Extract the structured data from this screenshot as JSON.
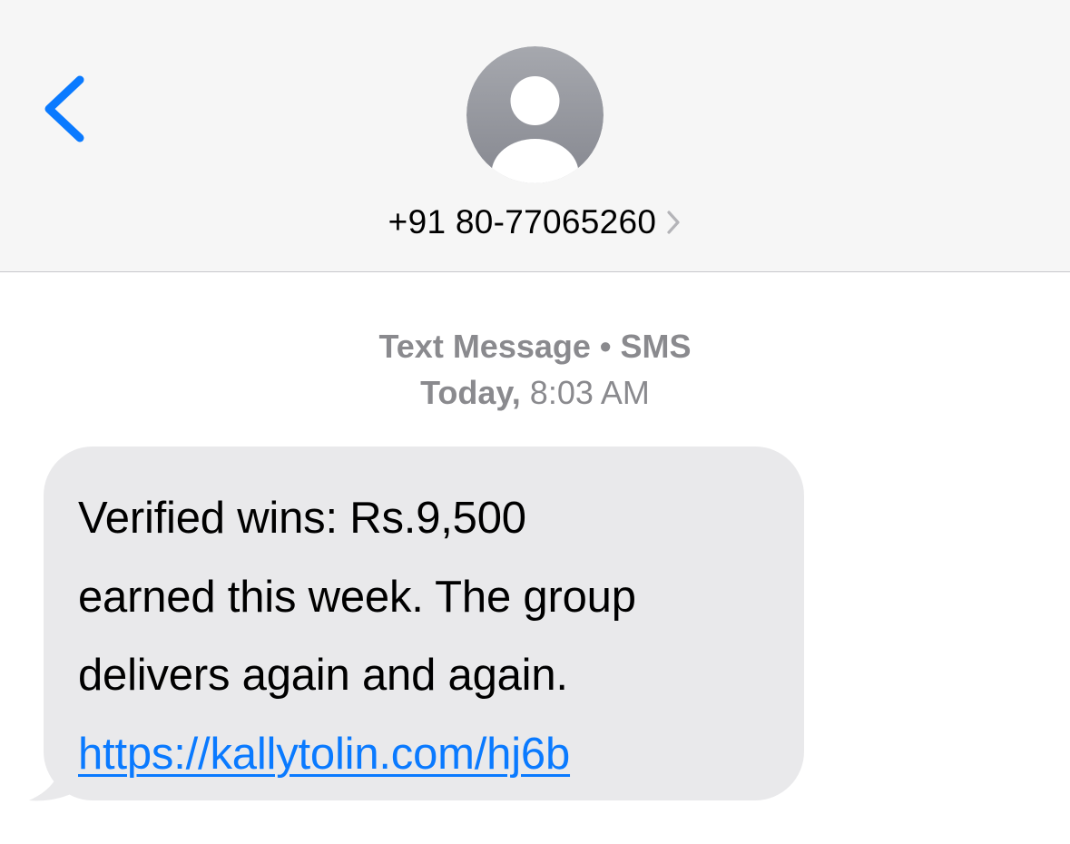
{
  "header": {
    "back_icon": "chevron-left-icon",
    "avatar_icon": "person-placeholder-icon",
    "contact_number": "+91 80-77065260",
    "contact_chevron_icon": "chevron-right-icon"
  },
  "conversation": {
    "service_label": "Text Message • SMS",
    "timestamp_day": "Today,",
    "timestamp_time": "8:03 AM"
  },
  "message": {
    "lines": [
      "Verified wins: Rs.9,500",
      "earned this week. The group",
      "delivers again and again."
    ],
    "link": "https://kallytolin.com/hj6b"
  },
  "colors": {
    "header_bg": "#f6f6f6",
    "accent_blue": "#0a7aff",
    "bubble_gray": "#e9e9eb",
    "meta_gray": "#8a8a8e",
    "avatar_gray": "#9a9ba1"
  }
}
